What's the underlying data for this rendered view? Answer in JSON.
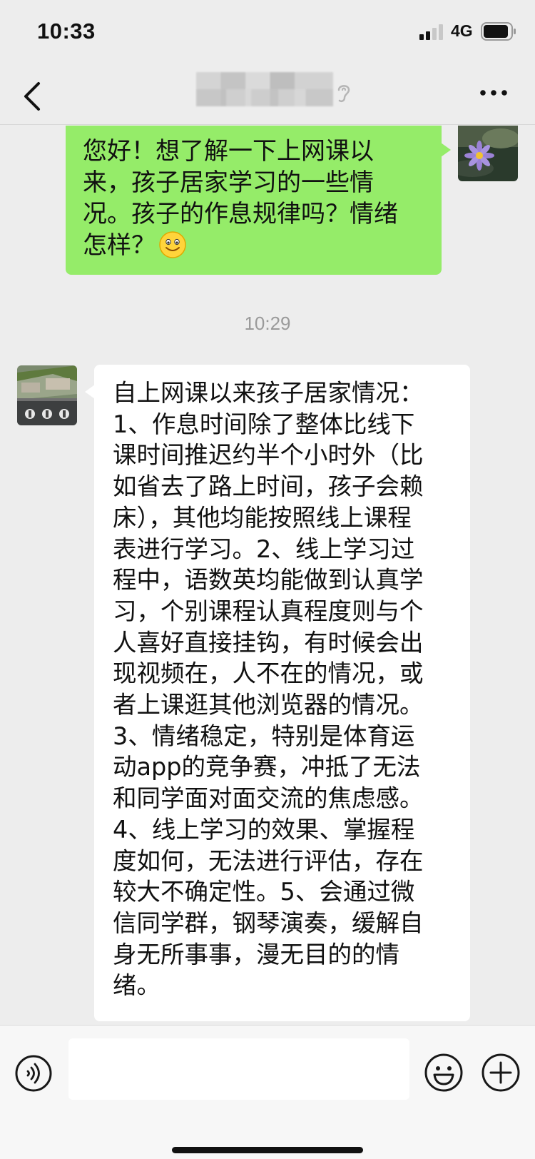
{
  "status_bar": {
    "time": "10:33",
    "network": "4G",
    "icons": [
      "signal-icon",
      "battery-icon"
    ]
  },
  "nav_bar": {
    "icons": [
      "back-icon",
      "ear-icon",
      "more-icon"
    ]
  },
  "messages": {
    "outgoing": {
      "lines": [
        "您好！想了解一下上网课以",
        "来，孩子居家学习的一些情",
        "况。孩子的作息规律吗？情绪",
        "怎样？"
      ],
      "emoji": "smile-emoji"
    },
    "timestamp": "10:29",
    "incoming": {
      "lines": [
        "自上网课以来孩子居家情况：",
        "1、作息时间除了整体比线下",
        "课时间推迟约半个小时外（比",
        "如省去了路上时间，孩子会赖",
        "床），其他均能按照线上课程",
        "表进行学习。2、线上学习过",
        "程中，语数英均能做到认真学",
        "习，个别课程认真程度则与个",
        "人喜好直接挂钩，有时候会出",
        "现视频在，人不在的情况，或",
        "者上课逛其他浏览器的情况。",
        "3、情绪稳定，特别是体育运",
        "动app的竞争赛，冲抵了无法",
        "和同学面对面交流的焦虑感。",
        "4、线上学习的效果、掌握程",
        "度如何，无法进行评估，存在",
        "较大不确定性。5、会通过微",
        "信同学群，钢琴演奏，缓解自",
        "身无所事事，漫无目的的情",
        "绪。"
      ]
    }
  },
  "input_bar": {
    "placeholder": "",
    "icons": [
      "voice-icon",
      "emoji-icon",
      "plus-icon"
    ]
  },
  "colors": {
    "background": "#ededed",
    "outgoing_bubble": "#95ec69",
    "incoming_bubble": "#ffffff",
    "timestamp": "#9a9a9a"
  }
}
